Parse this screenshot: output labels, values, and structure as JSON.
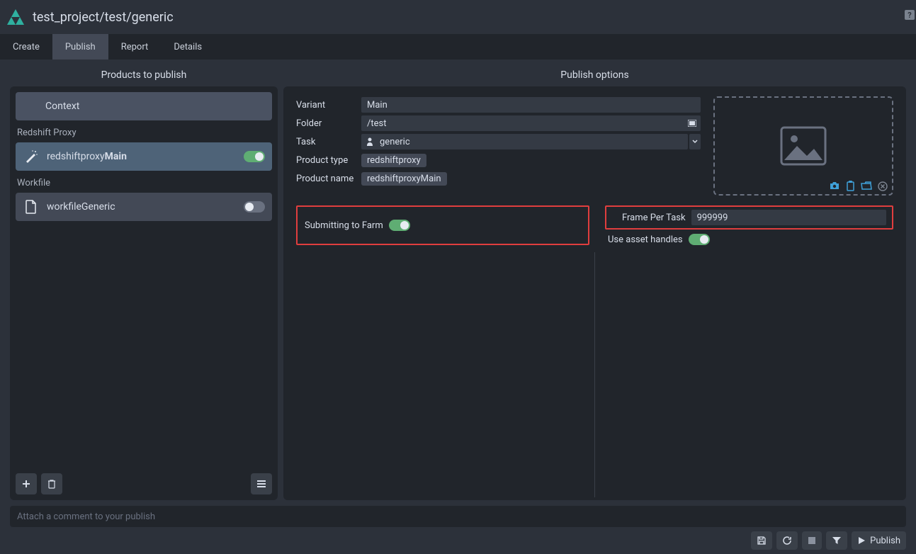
{
  "titlebar": {
    "path": "test_project/test/generic",
    "help": "?"
  },
  "tabs": {
    "create": "Create",
    "publish": "Publish",
    "report": "Report",
    "details": "Details"
  },
  "left": {
    "title": "Products to publish",
    "context": "Context",
    "groups": [
      {
        "label": "Redshift Proxy",
        "items": [
          {
            "prefix": "redshiftproxy",
            "bold": "Main",
            "icon": "wand",
            "on": true,
            "selected": true
          }
        ]
      },
      {
        "label": "Workfile",
        "items": [
          {
            "prefix": "workfileGeneric",
            "bold": "",
            "icon": "file",
            "on": false,
            "selected": false
          }
        ]
      }
    ]
  },
  "right": {
    "title": "Publish options",
    "variant_label": "Variant",
    "variant_value": "Main",
    "folder_label": "Folder",
    "folder_value": "/test",
    "task_label": "Task",
    "task_value": "generic",
    "ptype_label": "Product type",
    "ptype_value": "redshiftproxy",
    "pname_label": "Product name",
    "pname_value": "redshiftproxyMain",
    "farm_label": "Submitting to Farm",
    "fpt_label": "Frame Per Task",
    "fpt_value": "999999",
    "handles_label": "Use asset handles"
  },
  "comment": {
    "placeholder": "Attach a comment to your publish"
  },
  "footer": {
    "publish": "Publish"
  }
}
